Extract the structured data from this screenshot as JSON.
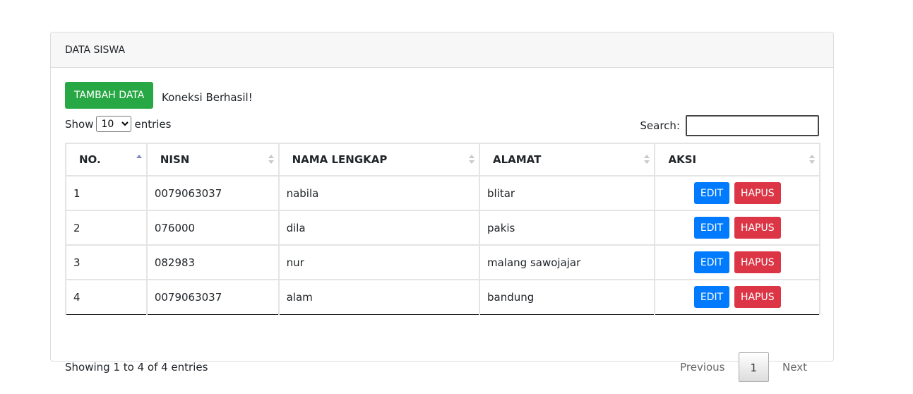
{
  "card": {
    "title": "DATA SISWA"
  },
  "toolbar": {
    "add_label": "TAMBAH DATA",
    "connection_message": "Koneksi Berhasil!"
  },
  "length": {
    "prefix": "Show",
    "selected": "10",
    "options": [
      "10"
    ],
    "suffix": "entries"
  },
  "search": {
    "label": "Search:",
    "value": ""
  },
  "table": {
    "headers": [
      "NO.",
      "NISN",
      "NAMA LENGKAP",
      "ALAMAT",
      "AKSI"
    ],
    "rows": [
      {
        "no": "1",
        "nisn": "0079063037",
        "nama": "nabila",
        "alamat": "blitar"
      },
      {
        "no": "2",
        "nisn": "076000",
        "nama": "dila",
        "alamat": "pakis"
      },
      {
        "no": "3",
        "nisn": "082983",
        "nama": "nur",
        "alamat": "malang sawojajar"
      },
      {
        "no": "4",
        "nisn": "0079063037",
        "nama": "alam",
        "alamat": "bandung"
      }
    ],
    "actions": {
      "edit_label": "EDIT",
      "delete_label": "HAPUS"
    }
  },
  "footer": {
    "info": "Showing 1 to 4 of 4 entries"
  },
  "pagination": {
    "previous": "Previous",
    "current": "1",
    "next": "Next"
  },
  "colors": {
    "add": "#28a745",
    "edit": "#007bff",
    "delete": "#dc3545"
  },
  "icons": {
    "sort": "sort-both-icon",
    "sort_active": "sort-asc-icon"
  }
}
